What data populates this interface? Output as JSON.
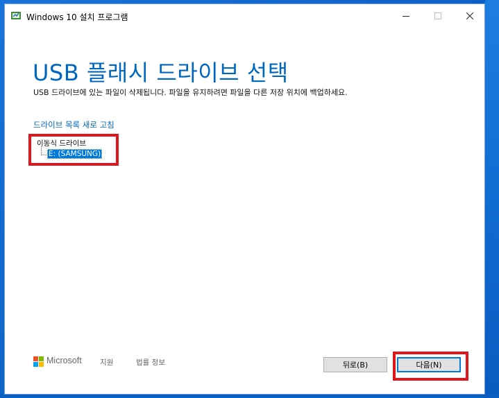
{
  "window": {
    "title": "Windows 10 설치 프로그램",
    "controls": {
      "minimize": "minimize-icon",
      "maximize": "maximize-icon",
      "close": "close-icon"
    }
  },
  "main": {
    "heading": "USB 플래시 드라이브 선택",
    "description": "USB 드라이브에 있는 파일이 삭제됩니다. 파일을 유지하려면 파일을 다른 저장 위치에 백업하세요.",
    "refresh_link": "드라이브 목록 새로 고침",
    "tree": {
      "root_label": "이동식 드라이브",
      "items": [
        {
          "label": "E: (SAMSUNG)",
          "selected": true
        }
      ]
    }
  },
  "footer": {
    "brand": "Microsoft",
    "links": [
      "지원",
      "법률 정보"
    ],
    "buttons": {
      "back": "뒤로(B)",
      "next": "다음(N)"
    }
  },
  "colors": {
    "accent": "#0067c0",
    "selection": "#0078d7",
    "highlight_annotation": "#e2141d",
    "ms_logo": [
      "#f25022",
      "#7fba00",
      "#00a4ef",
      "#ffb900"
    ]
  }
}
